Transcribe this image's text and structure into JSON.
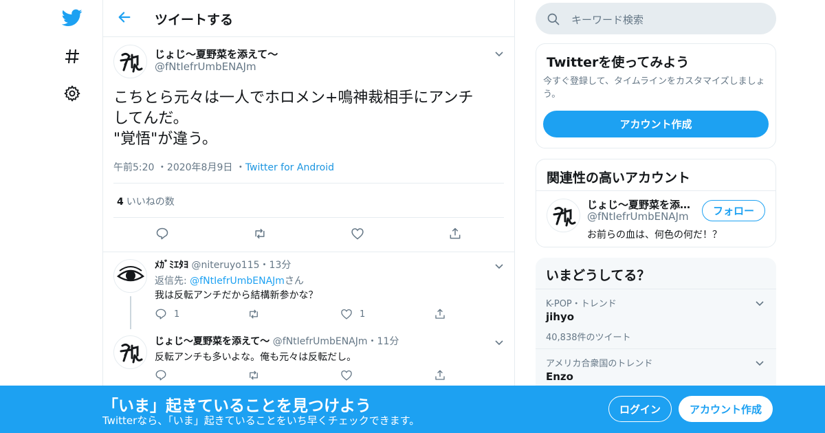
{
  "colors": {
    "accent": "#1da1f2",
    "secondary_text": "#657786",
    "border": "#e6ecf0",
    "banner": "#1da1f2"
  },
  "nav": {
    "icons": [
      "twitter-bird-icon",
      "hashtag-icon",
      "gear-icon"
    ]
  },
  "header": {
    "title": "ツイートする"
  },
  "main_tweet": {
    "name": "じょじ～夏野菜を添えて～",
    "handle": "@fNtIefrUmbENAJm",
    "text_lines": [
      "こちとら元々は一人でホロメン+鳴神裁相手にアンチ",
      "してんだ。",
      "\"覚悟\"が違う。"
    ],
    "time": "午前5:20",
    "date": "2020年8月9日",
    "source": "Twitter for Android",
    "likes_count": "4",
    "likes_label": "いいねの数"
  },
  "replies": [
    {
      "name": "ﾒｶﾞﾐｴﾀﾖ",
      "handle": "@niteruyo115",
      "time": "13分",
      "reply_to_prefix": "返信先: ",
      "reply_to_handle": "@fNtIefrUmbENAJm",
      "reply_to_suffix": "さん",
      "text": "我は反転アンチだから結構新参かな？",
      "reply_count": "1",
      "like_count": "1"
    },
    {
      "name": "じょじ～夏野菜を添えて～",
      "handle": "@fNtIefrUmbENAJm",
      "time": "11分",
      "text": "反転アンチも多いよな。俺も元々は反転だし。"
    }
  ],
  "search": {
    "placeholder": "キーワード検索"
  },
  "signup_card": {
    "title": "Twitterを使ってみよう",
    "desc_line1": "今すぐ登録して、タイムラインをカスタマイズしましょ",
    "desc_line2": "う。",
    "button": "アカウント作成"
  },
  "related_card": {
    "title": "関連性の高いアカウント",
    "name": "じょじ～夏野菜を添…",
    "handle": "@fNtIefrUmbENAJm",
    "bio": "お前らの血は、何色の何だ！？",
    "follow": "フォロー"
  },
  "trends": {
    "title": "いまどうしてる？",
    "items": [
      {
        "context": "K-POP・トレンド",
        "name": "jihyo",
        "count": "40,838件のツイート"
      },
      {
        "context": "アメリカ合衆国のトレンド",
        "name": "Enzo"
      }
    ]
  },
  "banner": {
    "title": "「いま」起きていることを見つけよう",
    "subtitle": "Twitterなら、「いま」起きていることをいち早くチェックできます。",
    "login": "ログイン",
    "signup": "アカウント作成"
  }
}
